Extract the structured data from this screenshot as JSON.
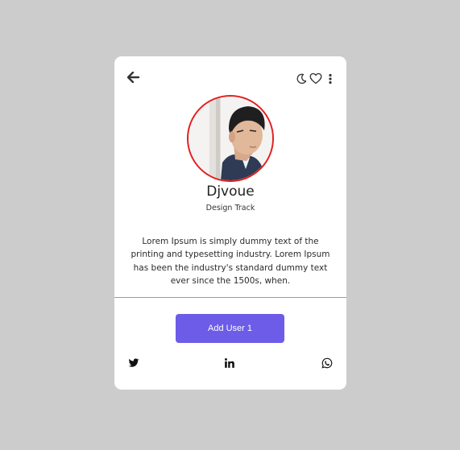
{
  "profile": {
    "name": "Djvoue",
    "track": "Design Track",
    "description": "Lorem Ipsum is simply dummy text of the printing and typesetting industry. Lorem Ipsum has been the industry's standard dummy text ever since the 1500s, when."
  },
  "actions": {
    "add_user_label": "Add User 1"
  },
  "header_icons": [
    "back-arrow",
    "moon",
    "heart",
    "more-vertical"
  ],
  "social_icons": [
    "twitter",
    "linkedin",
    "whatsapp"
  ],
  "colors": {
    "background": "#cccccc",
    "card": "#ffffff",
    "accent": "#6c5ce7",
    "avatar_border": "#e01e1e"
  }
}
